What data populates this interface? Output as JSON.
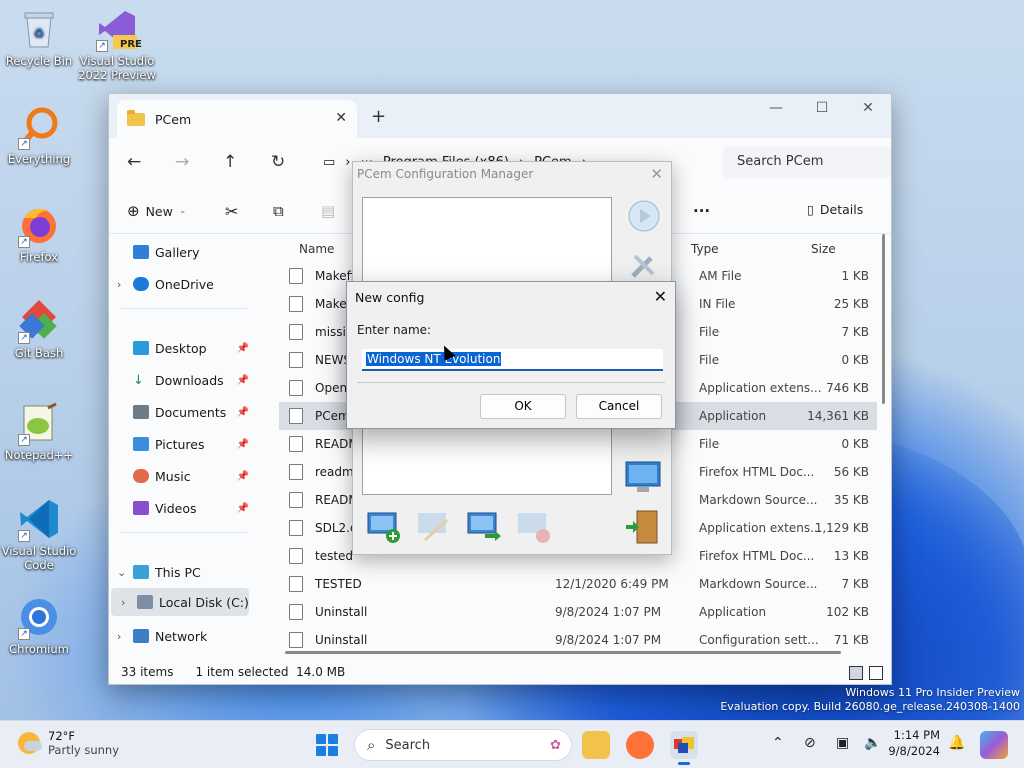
{
  "desktop": {
    "icons": [
      {
        "label": "Recycle Bin"
      },
      {
        "label": "Visual Studio 2022 Preview"
      },
      {
        "label": "Everything"
      },
      {
        "label": "Firefox"
      },
      {
        "label": "Git Bash"
      },
      {
        "label": "Notepad++"
      },
      {
        "label": "Visual Studio Code"
      },
      {
        "label": "Chromium"
      }
    ],
    "vs_badge": "PRE"
  },
  "explorer": {
    "tab_title": "PCem",
    "new_tab_symbol": "+",
    "breadcrumb": [
      "Program Files (x86)",
      "PCem"
    ],
    "breadcrumb_more": "···",
    "search_placeholder": "Search PCem",
    "commands": {
      "new_label": "New",
      "more_symbol": "···",
      "details_label": "Details"
    },
    "sidebar": [
      {
        "label": "Gallery"
      },
      {
        "label": "OneDrive"
      },
      {
        "label": "Desktop"
      },
      {
        "label": "Downloads"
      },
      {
        "label": "Documents"
      },
      {
        "label": "Pictures"
      },
      {
        "label": "Music"
      },
      {
        "label": "Videos"
      },
      {
        "label": "This PC"
      },
      {
        "label": "Local Disk (C:)"
      },
      {
        "label": "Network"
      }
    ],
    "columns": {
      "name": "Name",
      "type": "Type",
      "size": "Size"
    },
    "rows": [
      {
        "name": "Makefile",
        "date": "",
        "type": "AM File",
        "size": "1 KB"
      },
      {
        "name": "Makefile",
        "date": "",
        "type": "IN File",
        "size": "25 KB"
      },
      {
        "name": "missing",
        "date": "",
        "type": "File",
        "size": "7 KB"
      },
      {
        "name": "NEWS",
        "date": "",
        "type": "File",
        "size": "0 KB"
      },
      {
        "name": "OpenAL",
        "date": "",
        "type": "Application extens...",
        "size": "746 KB"
      },
      {
        "name": "PCem",
        "date": "",
        "type": "Application",
        "size": "14,361 KB"
      },
      {
        "name": "README",
        "date": "",
        "type": "File",
        "size": "0 KB"
      },
      {
        "name": "readme",
        "date": "",
        "type": "Firefox HTML Doc...",
        "size": "56 KB"
      },
      {
        "name": "README",
        "date": "",
        "type": "Markdown Source...",
        "size": "35 KB"
      },
      {
        "name": "SDL2.dll",
        "date": "",
        "type": "Application extens...",
        "size": "1,129 KB"
      },
      {
        "name": "tested",
        "date": "",
        "type": "Firefox HTML Doc...",
        "size": "13 KB"
      },
      {
        "name": "TESTED",
        "date": "12/1/2020 6:49 PM",
        "type": "Markdown Source...",
        "size": "7 KB"
      },
      {
        "name": "Uninstall",
        "date": "9/8/2024 1:07 PM",
        "type": "Application",
        "size": "102 KB"
      },
      {
        "name": "Uninstall",
        "date": "9/8/2024 1:07 PM",
        "type": "Configuration sett...",
        "size": "71 KB"
      }
    ],
    "status": {
      "items": "33 items",
      "selected": "1 item selected",
      "size": "14.0 MB"
    }
  },
  "pcem": {
    "title": "PCem Configuration Manager",
    "close": "✕"
  },
  "new_config": {
    "title": "New config",
    "close": "✕",
    "prompt": "Enter name:",
    "value": "Windows NT Evolution",
    "ok": "OK",
    "cancel": "Cancel"
  },
  "watermark": {
    "line1": "Windows 11 Pro Insider Preview",
    "line2": "Evaluation copy. Build 26080.ge_release.240308-1400"
  },
  "taskbar": {
    "temp": "72°F",
    "condition": "Partly sunny",
    "search": "Search",
    "time": "1:14 PM",
    "date": "9/8/2024"
  },
  "colors": {
    "accent": "#1a5fb4",
    "selection": "#0a64d1",
    "folder": "#f3c24b"
  }
}
